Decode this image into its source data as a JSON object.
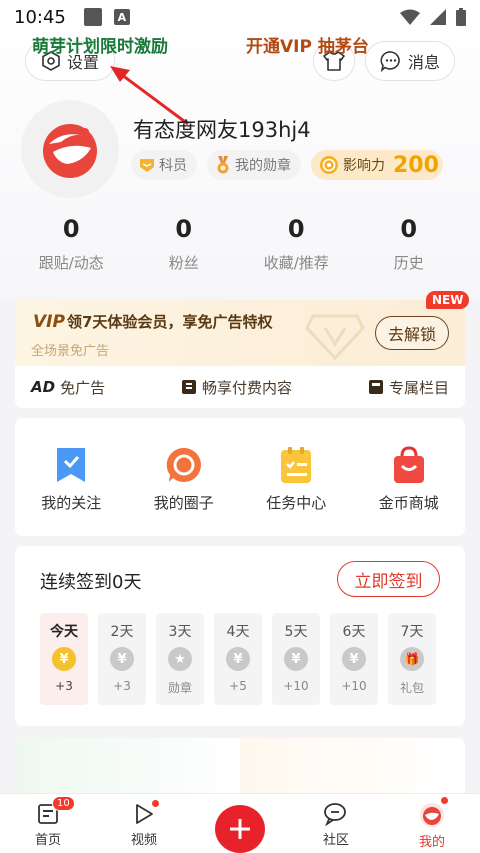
{
  "status_bar": {
    "time": "10:45",
    "a_badge": "A"
  },
  "header": {
    "settings_label": "设置",
    "messages_label": "消息"
  },
  "profile": {
    "username": "有态度网友193hj4",
    "badges": {
      "rank": "科员",
      "medals": "我的勋章",
      "influence_label": "影响力",
      "influence_value": "200"
    }
  },
  "stats": [
    {
      "value": "0",
      "label": "跟贴/动态"
    },
    {
      "value": "0",
      "label": "粉丝"
    },
    {
      "value": "0",
      "label": "收藏/推荐"
    },
    {
      "value": "0",
      "label": "历史"
    }
  ],
  "vip": {
    "logo": "VIP",
    "title": "领7天体验会员，享免广告特权",
    "subtitle": "全场景免广告",
    "unlock_label": "去解锁",
    "new_tag": "NEW",
    "features": {
      "no_ads": "免广告",
      "paid_content": "畅享付费内容",
      "columns": "专属栏目"
    }
  },
  "quick_grid": [
    {
      "label": "我的关注",
      "icon": "bookmark-icon"
    },
    {
      "label": "我的圈子",
      "icon": "circle-icon"
    },
    {
      "label": "任务中心",
      "icon": "task-icon"
    },
    {
      "label": "金币商城",
      "icon": "shopping-bag-icon"
    }
  ],
  "sign_in": {
    "title": "连续签到0天",
    "button": "立即签到",
    "days": [
      {
        "label": "今天",
        "reward": "+3",
        "coin": "¥"
      },
      {
        "label": "2天",
        "reward": "+3",
        "coin": "¥"
      },
      {
        "label": "3天",
        "reward": "勋章",
        "coin": "★"
      },
      {
        "label": "4天",
        "reward": "+5",
        "coin": "¥"
      },
      {
        "label": "5天",
        "reward": "+10",
        "coin": "¥"
      },
      {
        "label": "6天",
        "reward": "+10",
        "coin": "¥"
      },
      {
        "label": "7天",
        "reward": "礼包",
        "coin": "🎁"
      }
    ]
  },
  "promos": {
    "left": "萌芽计划限时激励",
    "right": "开通VIP 抽茅台"
  },
  "bottom_nav": {
    "home": "首页",
    "home_badge": "10",
    "video": "视频",
    "community": "社区",
    "mine": "我的"
  },
  "colors": {
    "accent_red": "#e8222a",
    "gold": "#f1a400",
    "vip_brown": "#5a3a14"
  }
}
